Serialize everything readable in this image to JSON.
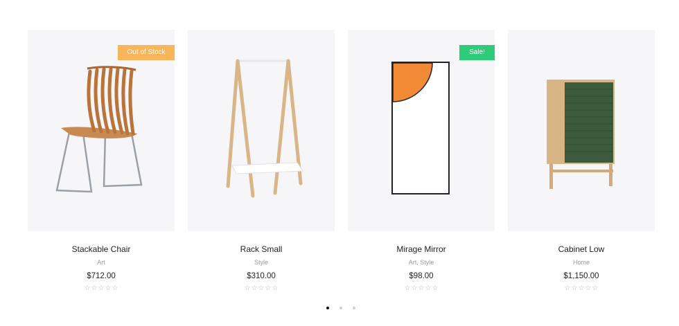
{
  "products": [
    {
      "name": "Stackable Chair",
      "category": "Art",
      "price": "$712.00",
      "badge": "Out of Stock",
      "rating_stars": 5,
      "rating_filled": 0
    },
    {
      "name": "Rack Small",
      "category": "Style",
      "price": "$310.00",
      "badge": "",
      "rating_stars": 5,
      "rating_filled": 0
    },
    {
      "name": "Mirage Mirror",
      "category": "Art, Style",
      "price": "$98.00",
      "badge": "Sale!",
      "rating_stars": 5,
      "rating_filled": 0
    },
    {
      "name": "Cabinet Low",
      "category": "Home",
      "price": "$1,150.00",
      "badge": "",
      "rating_stars": 5,
      "rating_filled": 0
    }
  ],
  "carousel": {
    "pages": 3,
    "active_page": 1
  },
  "colors": {
    "out_of_stock": "#f9b55a",
    "sale": "#2ecc7a",
    "thumb_bg": "#f6f6f8"
  },
  "icons": {
    "star": "star-outline-icon"
  }
}
